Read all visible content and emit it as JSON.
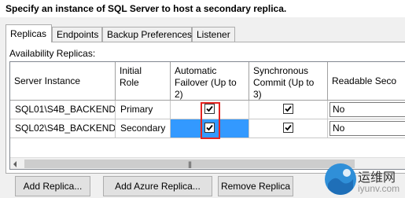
{
  "instruction": "Specify an instance of SQL Server to host a secondary replica.",
  "tabs": [
    {
      "label": "Replicas",
      "active": true
    },
    {
      "label": "Endpoints",
      "active": false
    },
    {
      "label": "Backup Preferences",
      "active": false
    },
    {
      "label": "Listener",
      "active": false
    }
  ],
  "group_label": "Availability Replicas:",
  "grid": {
    "columns": [
      "Server Instance",
      "Initial Role",
      "Automatic Failover (Up to 2)",
      "Synchronous Commit (Up to 3)",
      "Readable Seco"
    ],
    "rows": [
      {
        "server": "SQL01\\S4B_BACKEND",
        "role": "Primary",
        "auto_failover": true,
        "sync_commit": true,
        "readable": "No"
      },
      {
        "server": "SQL02\\S4B_BACKEND",
        "role": "Secondary",
        "auto_failover": true,
        "sync_commit": true,
        "readable": "No"
      }
    ]
  },
  "buttons": {
    "add_replica": "Add Replica...",
    "add_azure_replica": "Add Azure Replica...",
    "remove_replica": "Remove Replica"
  },
  "watermark": {
    "text": "运维网",
    "subtext": "iyunv.com"
  },
  "colors": {
    "selection": "#3399ff",
    "highlight_box": "#e52420"
  }
}
